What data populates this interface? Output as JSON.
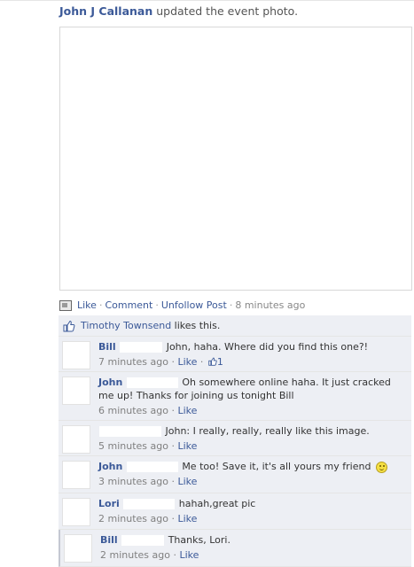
{
  "story": {
    "author": "John J Callanan",
    "action": " updated the event photo."
  },
  "actions": {
    "like": "Like",
    "comment": "Comment",
    "unfollow": "Unfollow Post",
    "time": "8 minutes ago",
    "separator": "·"
  },
  "likes": {
    "name": "Timothy Townsend",
    "suffix": " likes this."
  },
  "comments": [
    {
      "name": "Bill",
      "text": "John, haha. Where did you find this one?!",
      "time": "7 minutes ago",
      "like": "Like",
      "like_count": "1"
    },
    {
      "name": "John",
      "text": "Oh somewhere online haha. It just cracked me up! Thanks for joining us tonight Bill",
      "time": "6 minutes ago",
      "like": "Like"
    },
    {
      "name": "",
      "text": "John: I really, really, really like this image.",
      "time": "5 minutes ago",
      "like": "Like"
    },
    {
      "name": "John",
      "text": "Me too! Save it, it's all yours my friend",
      "time": "3 minutes ago",
      "like": "Like"
    },
    {
      "name": "Lori",
      "text": "hahah,great pic",
      "time": "2 minutes ago",
      "like": "Like"
    },
    {
      "name": "Bill",
      "text": "Thanks, Lori.",
      "time": "2 minutes ago",
      "like": "Like"
    }
  ],
  "colors": {
    "link": "#3b5998",
    "ufi_bg": "#edeff4"
  }
}
